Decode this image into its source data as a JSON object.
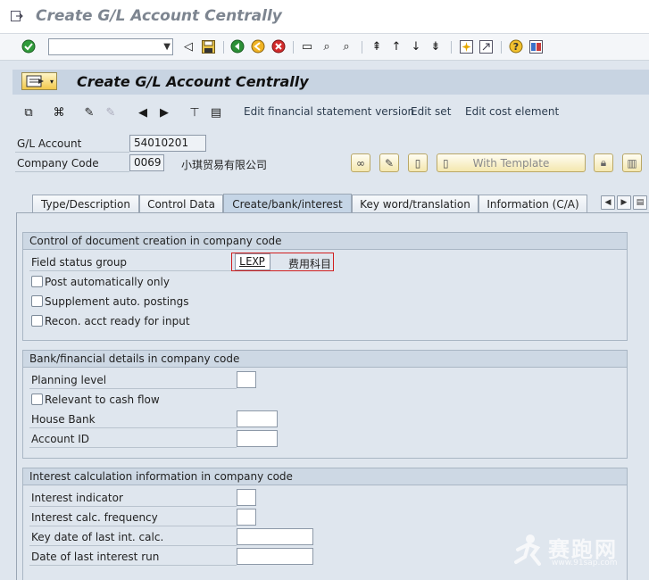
{
  "window": {
    "title": "Create G/L Account Centrally"
  },
  "system_toolbar": {
    "command_field": {
      "value": "",
      "placeholder": ""
    },
    "icons": [
      "enter-icon",
      "save-icon",
      "back-icon",
      "exit-icon",
      "cancel-icon",
      "print-icon",
      "find-icon",
      "find-next-icon",
      "first-page-icon",
      "previous-page-icon",
      "next-page-icon",
      "last-page-icon",
      "new-session-icon",
      "shortcut-icon",
      "help-icon",
      "customize-layout-icon"
    ]
  },
  "screen": {
    "title": "Create G/L Account Centrally"
  },
  "app_toolbar": {
    "links": [
      "Edit financial statement version",
      "Edit set",
      "Edit cost element"
    ]
  },
  "header": {
    "gl_account_label": "G/L Account",
    "gl_account_value": "54010201",
    "company_code_label": "Company Code",
    "company_code_value": "0069",
    "company_name": "小琪贸易有限公司",
    "with_template_label": "With Template"
  },
  "tabs": [
    {
      "label": "Type/Description",
      "active": false
    },
    {
      "label": "Control Data",
      "active": false
    },
    {
      "label": "Create/bank/interest",
      "active": true
    },
    {
      "label": "Key word/translation",
      "active": false
    },
    {
      "label": "Information (C/A)",
      "active": false
    }
  ],
  "group_document": {
    "title": "Control of document creation in company code",
    "field_status_group_label": "Field status group",
    "field_status_group_value": "LEXP",
    "field_status_group_desc": "费用科目",
    "post_auto_label": "Post automatically only",
    "supplement_label": "Supplement auto. postings",
    "recon_label": "Recon. acct ready for input"
  },
  "group_bank": {
    "title": "Bank/financial details in company code",
    "planning_level_label": "Planning level",
    "planning_level_value": "",
    "cash_flow_label": "Relevant to cash flow",
    "house_bank_label": "House Bank",
    "house_bank_value": "",
    "account_id_label": "Account ID",
    "account_id_value": ""
  },
  "group_interest": {
    "title": "Interest calculation information in company code",
    "indicator_label": "Interest indicator",
    "indicator_value": "",
    "frequency_label": "Interest calc. frequency",
    "frequency_value": "",
    "key_date_label": "Key date of last int. calc.",
    "key_date_value": "",
    "last_run_label": "Date of last interest run",
    "last_run_value": ""
  },
  "watermark": {
    "text": "赛跑网",
    "url": "www.91sap.com"
  },
  "colors": {
    "accent": "#d11f1f",
    "header_bg": "#c8d4e2",
    "panel_bg": "#dfe6ee"
  }
}
